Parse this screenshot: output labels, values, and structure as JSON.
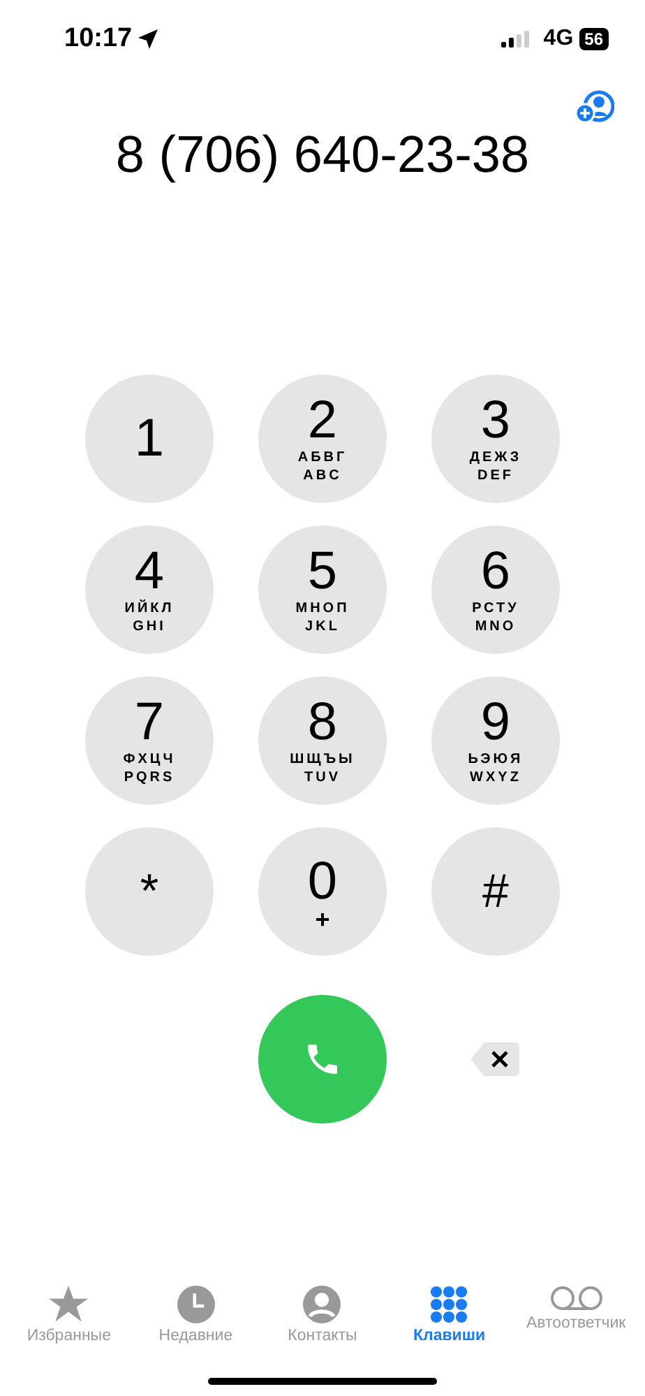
{
  "status_bar": {
    "time": "10:17",
    "network": "4G",
    "battery": "56"
  },
  "number": "8 (706) 640-23-38",
  "keys": [
    {
      "digit": "1"
    },
    {
      "digit": "2",
      "letters": [
        "АБВГ",
        "ABC"
      ]
    },
    {
      "digit": "3",
      "letters": [
        "ДЕЖЗ",
        "DEF"
      ]
    },
    {
      "digit": "4",
      "letters": [
        "ИЙКЛ",
        "GHI"
      ]
    },
    {
      "digit": "5",
      "letters": [
        "МНОП",
        "JKL"
      ]
    },
    {
      "digit": "6",
      "letters": [
        "РСТУ",
        "MNO"
      ]
    },
    {
      "digit": "7",
      "letters": [
        "ФХЦЧ",
        "PQRS"
      ]
    },
    {
      "digit": "8",
      "letters": [
        "ШЩЪЫ",
        "TUV"
      ]
    },
    {
      "digit": "9",
      "letters": [
        "ЬЭЮЯ",
        "WXYZ"
      ]
    },
    {
      "digit": "*"
    },
    {
      "digit": "0",
      "letters": [
        "+"
      ]
    },
    {
      "digit": "#"
    }
  ],
  "tabs": [
    {
      "label": "Избранные",
      "kind": "star",
      "selected": false
    },
    {
      "label": "Недавние",
      "kind": "clock",
      "selected": false
    },
    {
      "label": "Контакты",
      "kind": "person",
      "selected": false
    },
    {
      "label": "Клавиши",
      "kind": "keypad",
      "selected": true
    },
    {
      "label": "Автоответчик",
      "kind": "voicemail",
      "selected": false
    }
  ]
}
